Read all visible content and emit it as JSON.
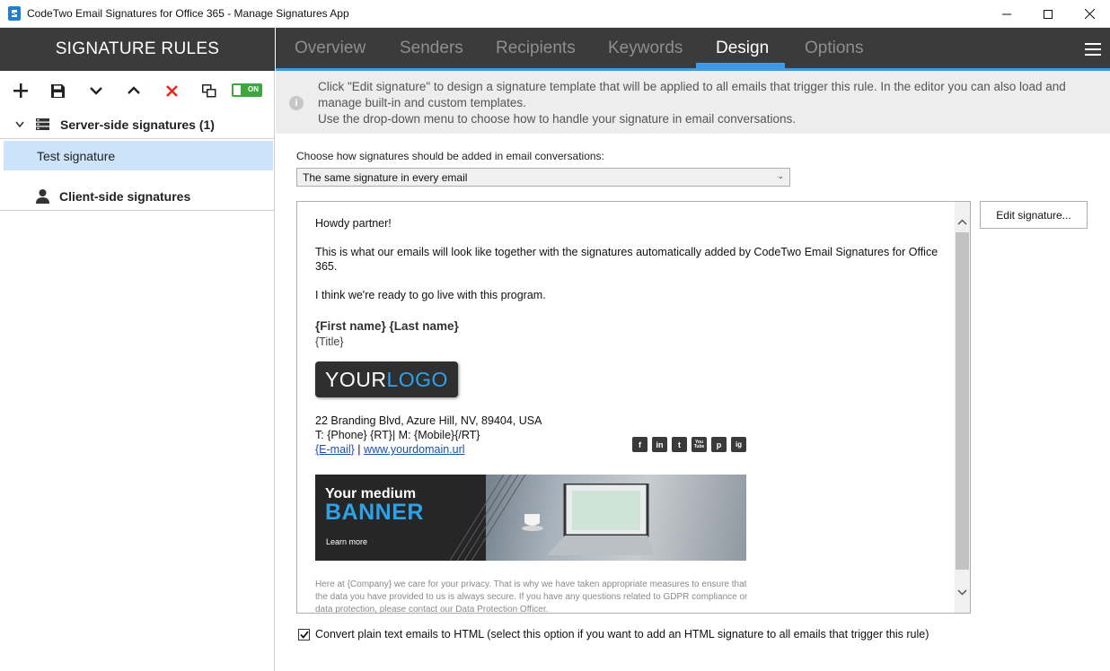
{
  "window": {
    "title": "CodeTwo Email Signatures for Office 365 - Manage Signatures App"
  },
  "left": {
    "header": "SIGNATURE RULES",
    "toggle_label": "ON",
    "groups": [
      {
        "label": "Server-side signatures  (1)"
      },
      {
        "label": "Client-side signatures"
      }
    ],
    "items": [
      {
        "label": "Test signature",
        "selected": true
      }
    ]
  },
  "tabs": [
    {
      "label": "Overview",
      "active": false
    },
    {
      "label": "Senders",
      "active": false
    },
    {
      "label": "Recipients",
      "active": false
    },
    {
      "label": "Keywords",
      "active": false
    },
    {
      "label": "Design",
      "active": true
    },
    {
      "label": "Options",
      "active": false
    }
  ],
  "info": {
    "line1": "Click \"Edit signature\" to design a signature template that will be applied to all emails that trigger this rule. In the editor you can also load and manage built-in and custom templates.",
    "line2": "Use the drop-down menu to choose how to handle your signature in email conversations."
  },
  "conversation": {
    "label": "Choose how signatures should be added in email conversations:",
    "selected": "The same signature in every email"
  },
  "email": {
    "greeting": "Howdy partner!",
    "body1": "This is what our emails will look like together with the signatures automatically added by CodeTwo Email Signatures for Office 365.",
    "body2": "I think we're ready to go live with this program.",
    "sig_name": "{First name} {Last name}",
    "sig_title": "{Title}",
    "logo_part1": "YOUR",
    "logo_part2": "LOGO",
    "address": "22 Branding Blvd, Azure Hill, NV, 89404, USA",
    "phones": "T: {Phone} {RT}| M: {Mobile}{/RT}",
    "email_link": "{E-mail}",
    "separator": "|",
    "website": "www.yourdomain.url",
    "social": [
      "f",
      "in",
      "t",
      "You Tube",
      "p",
      "ig"
    ],
    "banner_line1": "Your medium",
    "banner_line2": "BANNER",
    "banner_cta": "Learn more",
    "disclaimer": "Here at {Company} we care for your privacy. That is why we have taken appropriate measures to ensure that the data you have provided to us is always secure. If you have any questions related to GDPR compliance or data protection, please contact our Data Protection Officer."
  },
  "edit_button": "Edit signature...",
  "convert_checkbox": {
    "checked": true,
    "label": "Convert plain text emails to HTML (select this option if you want to add an HTML signature to all emails that trigger this rule)"
  },
  "colors": {
    "dark_header": "#3b3b3b",
    "accent": "#3d9ae8",
    "selection": "#cde3f9",
    "toggle_on": "#3ea63e",
    "delete": "#e0281e"
  }
}
